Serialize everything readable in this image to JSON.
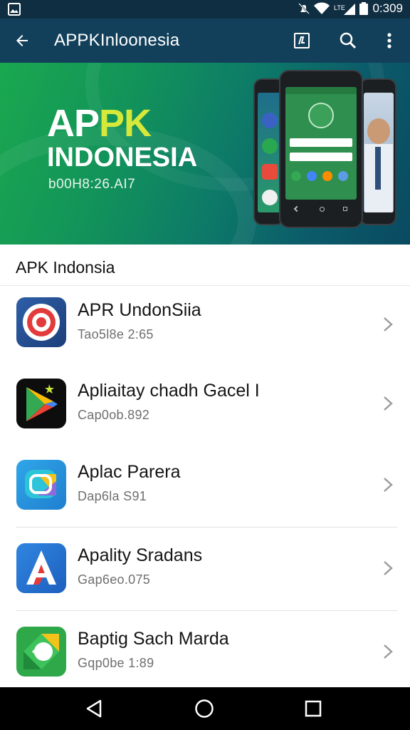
{
  "status_bar": {
    "time": "0:309",
    "icons": [
      "image-icon",
      "mute-icon",
      "wifi-icon",
      "signal-icon",
      "battery-icon"
    ]
  },
  "app_bar": {
    "title": "APPKInloonesia",
    "icons": [
      "back-arrow-icon",
      "edit-icon",
      "search-icon",
      "more-vert-icon"
    ]
  },
  "banner": {
    "title_white": "AP",
    "title_accent": "PK",
    "subtitle": "INDONESIA",
    "code": "b00H8:26.AI7",
    "colors": {
      "accent": "#d6e83a",
      "green": "#1aa84f",
      "teal": "#0a4a60"
    }
  },
  "section": {
    "title": "APK Indonsia"
  },
  "apps": [
    {
      "title": "APR UndonSiia",
      "subtitle": "Tao5l8e 2:65",
      "icon": "target-icon"
    },
    {
      "title": "Apliaitay chadh Gacel I",
      "subtitle": "Cap0ob.892",
      "icon": "play-store-icon"
    },
    {
      "title": "Aplac Parera",
      "subtitle": "Dap6la S91",
      "icon": "lens-icon"
    },
    {
      "title": "Apality Sradans",
      "subtitle": "Gap6eo.075",
      "icon": "letter-a-icon"
    },
    {
      "title": "Baptig Sach Marda",
      "subtitle": "Gqp0be 1:89",
      "icon": "diamond-icon"
    }
  ],
  "nav_bar": {
    "icons": [
      "nav-back-icon",
      "nav-home-icon",
      "nav-recents-icon"
    ]
  }
}
